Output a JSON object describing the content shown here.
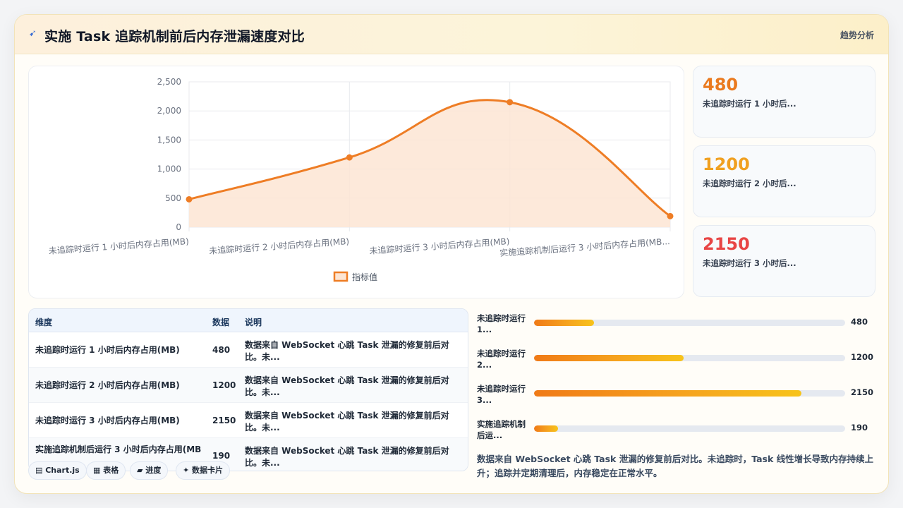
{
  "header": {
    "icon": "sparkle-icon",
    "title": "实施 Task 追踪机制前后内存泄漏速度对比",
    "action_label": "趋势分析"
  },
  "chart_data": {
    "type": "line",
    "categories": [
      "未追踪时运行 1 小时后内存占用(MB)",
      "未追踪时运行 2 小时后内存占用(MB)",
      "未追踪时运行 3 小时后内存占用(MB)",
      "实施追踪机制后运行 3 小时后内存占用(MB)"
    ],
    "tick_labels": [
      "未追踪时运行 1 小时后内存占用(MB)",
      "未追踪时运行 2 小时后内存占用(MB)",
      "未追踪时运行 3 小时后内存占用(MB)",
      "实施追踪机制后运行 3 小时后内存占用(MB..."
    ],
    "series": [
      {
        "name": "指标值",
        "values": [
          480,
          1200,
          2150,
          190
        ],
        "color": "#ee7d25",
        "fill": "#fde5d3"
      }
    ],
    "y_ticks": [
      "0",
      "500",
      "1,000",
      "1,500",
      "2,000",
      "2,500"
    ],
    "ylim": [
      0,
      2500
    ],
    "grid": true,
    "legend": "bottom",
    "smooth": true
  },
  "stats": [
    {
      "value": "480",
      "label": "未追踪时运行 1 小时后...",
      "color": "#ea7a1f"
    },
    {
      "value": "1200",
      "label": "未追踪时运行 2 小时后...",
      "color": "#f0a020"
    },
    {
      "value": "2150",
      "label": "未追踪时运行 3 小时后...",
      "color": "#e84545"
    }
  ],
  "table": {
    "headers": [
      "维度",
      "数据",
      "说明"
    ],
    "rows": [
      {
        "dim": "未追踪时运行 1 小时后内存占用(MB)",
        "val": "480",
        "desc": "数据来自 WebSocket 心跳 Task 泄漏的修复前后对比。未..."
      },
      {
        "dim": "未追踪时运行 2 小时后内存占用(MB)",
        "val": "1200",
        "desc": "数据来自 WebSocket 心跳 Task 泄漏的修复前后对比。未..."
      },
      {
        "dim": "未追踪时运行 3 小时后内存占用(MB)",
        "val": "2150",
        "desc": "数据来自 WebSocket 心跳 Task 泄漏的修复前后对比。未..."
      },
      {
        "dim": "实施追踪机制后运行 3 小时后内存占用(MB",
        "val": "190",
        "desc": "数据来自 WebSocket 心跳 Task 泄漏的修复前后对比。未..."
      }
    ]
  },
  "chips": [
    {
      "label": "▤ Chart.js",
      "icon": "chart-icon"
    },
    {
      "label": "▦ 表格",
      "icon": "table-icon"
    },
    {
      "label": "▰ 进度",
      "icon": "progress-icon"
    },
    {
      "label": "✦ 数据卡片",
      "icon": "card-icon"
    }
  ],
  "progress": {
    "max": 2500,
    "items": [
      {
        "label": "未追踪时运行 1...",
        "value": 480,
        "display": "480"
      },
      {
        "label": "未追踪时运行 2...",
        "value": 1200,
        "display": "1200"
      },
      {
        "label": "未追踪时运行 3...",
        "value": 2150,
        "display": "2150"
      },
      {
        "label": "实施追踪机制后运...",
        "value": 190,
        "display": "190"
      }
    ]
  },
  "note": "数据来自 WebSocket 心跳 Task 泄漏的修复前后对比。未追踪时，Task 线性增长导致内存持续上升；追踪并定期清理后，内存稳定在正常水平。"
}
